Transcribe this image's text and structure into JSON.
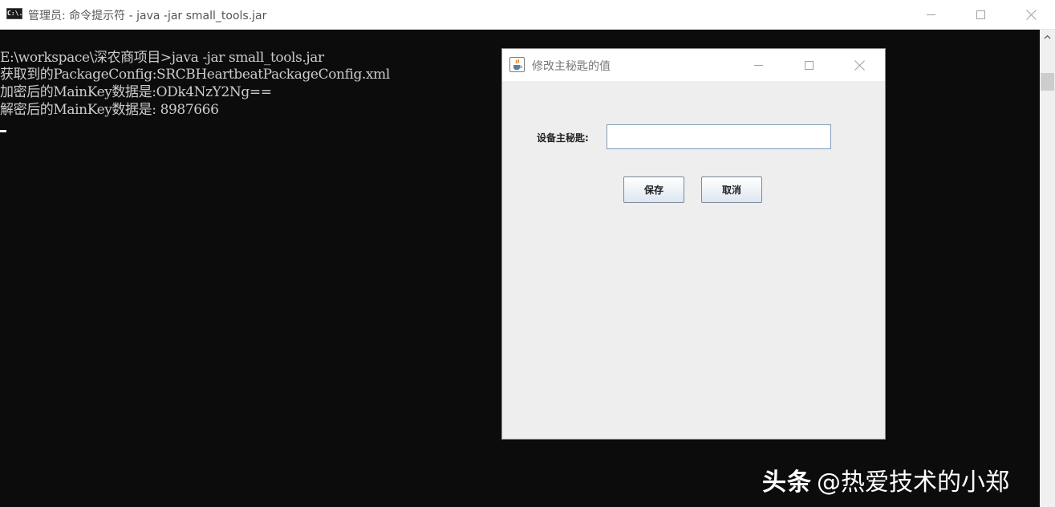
{
  "cmd_window": {
    "icon_text": "C:\\.",
    "title": "管理员: 命令提示符 - java  -jar small_tools.jar",
    "minimize_icon": "minimize-icon",
    "maximize_icon": "maximize-icon",
    "close_icon": "close-icon"
  },
  "console": {
    "lines": [
      "E:\\workspace\\深农商项目>java -jar small_tools.jar",
      "获取到的PackageConfig:SRCBHeartbeatPackageConfig.xml",
      "加密后的MainKey数据是:ODk4NzY2Ng==",
      "解密后的MainKey数据是: 8987666"
    ]
  },
  "dialog": {
    "title": "修改主秘匙的值",
    "icon": "java-cup-icon",
    "key_label": "设备主秘匙:",
    "key_value": "",
    "save_label": "保存",
    "cancel_label": "取消"
  },
  "watermark": {
    "brand": "头条",
    "handle": "@热爱技术的小郑"
  },
  "colors": {
    "console_bg": "#0c0c0c",
    "console_text": "#cccccc",
    "dialog_bg": "#eeeeee",
    "button_border": "#7a8a99"
  }
}
